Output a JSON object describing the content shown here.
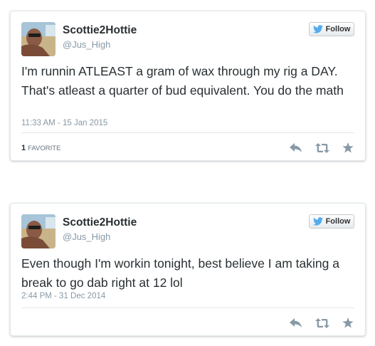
{
  "tweets": [
    {
      "user_name": "Scottie2Hottie",
      "user_handle": "@Jus_High",
      "follow_label": "Follow",
      "text": "I'm runnin ATLEAST a gram of wax through my rig a DAY. That's atleast a quarter of bud equivalent. You do the math",
      "timestamp": "11:33 AM - 15 Jan 2015",
      "favorite_count": "1",
      "favorite_label": "FAVORITE"
    },
    {
      "user_name": "Scottie2Hottie",
      "user_handle": "@Jus_High",
      "follow_label": "Follow",
      "text": "Even though I'm workin tonight, best believe I am taking a break to go dab right at 12 lol",
      "timestamp": "2:44 PM - 31 Dec 2014"
    }
  ],
  "icons": [
    "twitter-bird-icon",
    "reply-icon",
    "retweet-icon",
    "favorite-star-icon"
  ],
  "colors": {
    "text": "#292f33",
    "muted": "#8899a6",
    "twitter_blue": "#55acee",
    "action_gray": "#8899a6"
  }
}
